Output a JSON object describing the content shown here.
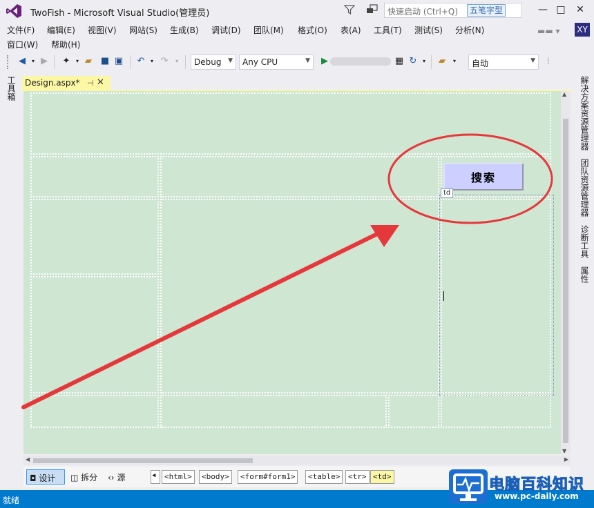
{
  "titlebar": {
    "title": "TwoFish - Microsoft Visual Studio(管理员)",
    "quick_launch_placeholder": "快速启动 (Ctrl+Q)",
    "ime_label": "五笔字型",
    "minimize": "—",
    "maximize": "□",
    "close": "✕"
  },
  "menu": {
    "row1": [
      "文件(F)",
      "编辑(E)",
      "视图(V)",
      "网站(S)",
      "生成(B)",
      "调试(D)",
      "团队(M)",
      "格式(O)",
      "表(A)",
      "工具(T)",
      "测试(S)",
      "分析(N)"
    ],
    "row2": [
      "窗口(W)",
      "帮助(H)"
    ],
    "avatar_initials": "XY"
  },
  "toolbar": {
    "config": "Debug",
    "platform": "Any CPU",
    "position": "自动"
  },
  "left_panel": {
    "toolbox": "工具箱"
  },
  "right_panel": {
    "solution_explorer": "解决方案资源管理器",
    "team_explorer": "团队资源管理器",
    "diagnostics": "诊断工具",
    "properties": "属性"
  },
  "document": {
    "tab_label": "Design.aspx*",
    "search_button": "搜索",
    "td_tag": "td"
  },
  "view_bar": {
    "design": "设计",
    "split": "拆分",
    "source": "源",
    "breadcrumbs": [
      "<html>",
      "<body>",
      "<form#form1>",
      "<table>",
      "<tr>",
      "<td>"
    ]
  },
  "status": {
    "text": "就绪"
  },
  "watermark": {
    "title": "电脑百科知识",
    "url": "www.pc-daily.com"
  },
  "colors": {
    "accent_blue": "#007acc",
    "design_surface": "#cfe6d2",
    "active_tab": "#fbf7a5",
    "annotation_red": "#e5383b",
    "search_button_bg": "#cccfff"
  }
}
